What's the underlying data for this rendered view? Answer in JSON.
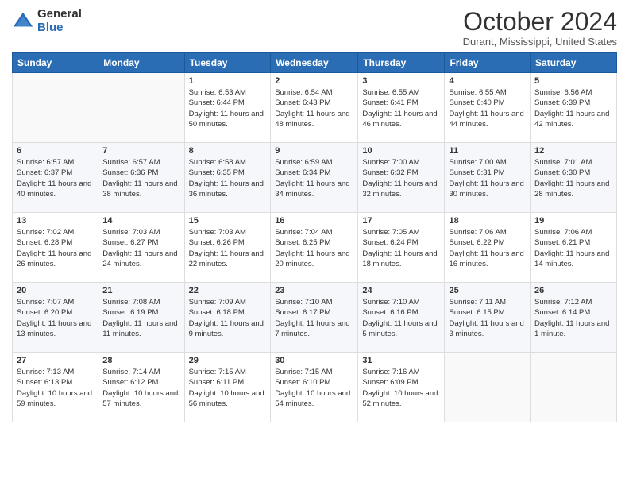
{
  "header": {
    "logo_general": "General",
    "logo_blue": "Blue",
    "month_title": "October 2024",
    "location": "Durant, Mississippi, United States"
  },
  "days_of_week": [
    "Sunday",
    "Monday",
    "Tuesday",
    "Wednesday",
    "Thursday",
    "Friday",
    "Saturday"
  ],
  "weeks": [
    [
      {
        "day": "",
        "info": ""
      },
      {
        "day": "",
        "info": ""
      },
      {
        "day": "1",
        "info": "Sunrise: 6:53 AM\nSunset: 6:44 PM\nDaylight: 11 hours and 50 minutes."
      },
      {
        "day": "2",
        "info": "Sunrise: 6:54 AM\nSunset: 6:43 PM\nDaylight: 11 hours and 48 minutes."
      },
      {
        "day": "3",
        "info": "Sunrise: 6:55 AM\nSunset: 6:41 PM\nDaylight: 11 hours and 46 minutes."
      },
      {
        "day": "4",
        "info": "Sunrise: 6:55 AM\nSunset: 6:40 PM\nDaylight: 11 hours and 44 minutes."
      },
      {
        "day": "5",
        "info": "Sunrise: 6:56 AM\nSunset: 6:39 PM\nDaylight: 11 hours and 42 minutes."
      }
    ],
    [
      {
        "day": "6",
        "info": "Sunrise: 6:57 AM\nSunset: 6:37 PM\nDaylight: 11 hours and 40 minutes."
      },
      {
        "day": "7",
        "info": "Sunrise: 6:57 AM\nSunset: 6:36 PM\nDaylight: 11 hours and 38 minutes."
      },
      {
        "day": "8",
        "info": "Sunrise: 6:58 AM\nSunset: 6:35 PM\nDaylight: 11 hours and 36 minutes."
      },
      {
        "day": "9",
        "info": "Sunrise: 6:59 AM\nSunset: 6:34 PM\nDaylight: 11 hours and 34 minutes."
      },
      {
        "day": "10",
        "info": "Sunrise: 7:00 AM\nSunset: 6:32 PM\nDaylight: 11 hours and 32 minutes."
      },
      {
        "day": "11",
        "info": "Sunrise: 7:00 AM\nSunset: 6:31 PM\nDaylight: 11 hours and 30 minutes."
      },
      {
        "day": "12",
        "info": "Sunrise: 7:01 AM\nSunset: 6:30 PM\nDaylight: 11 hours and 28 minutes."
      }
    ],
    [
      {
        "day": "13",
        "info": "Sunrise: 7:02 AM\nSunset: 6:28 PM\nDaylight: 11 hours and 26 minutes."
      },
      {
        "day": "14",
        "info": "Sunrise: 7:03 AM\nSunset: 6:27 PM\nDaylight: 11 hours and 24 minutes."
      },
      {
        "day": "15",
        "info": "Sunrise: 7:03 AM\nSunset: 6:26 PM\nDaylight: 11 hours and 22 minutes."
      },
      {
        "day": "16",
        "info": "Sunrise: 7:04 AM\nSunset: 6:25 PM\nDaylight: 11 hours and 20 minutes."
      },
      {
        "day": "17",
        "info": "Sunrise: 7:05 AM\nSunset: 6:24 PM\nDaylight: 11 hours and 18 minutes."
      },
      {
        "day": "18",
        "info": "Sunrise: 7:06 AM\nSunset: 6:22 PM\nDaylight: 11 hours and 16 minutes."
      },
      {
        "day": "19",
        "info": "Sunrise: 7:06 AM\nSunset: 6:21 PM\nDaylight: 11 hours and 14 minutes."
      }
    ],
    [
      {
        "day": "20",
        "info": "Sunrise: 7:07 AM\nSunset: 6:20 PM\nDaylight: 11 hours and 13 minutes."
      },
      {
        "day": "21",
        "info": "Sunrise: 7:08 AM\nSunset: 6:19 PM\nDaylight: 11 hours and 11 minutes."
      },
      {
        "day": "22",
        "info": "Sunrise: 7:09 AM\nSunset: 6:18 PM\nDaylight: 11 hours and 9 minutes."
      },
      {
        "day": "23",
        "info": "Sunrise: 7:10 AM\nSunset: 6:17 PM\nDaylight: 11 hours and 7 minutes."
      },
      {
        "day": "24",
        "info": "Sunrise: 7:10 AM\nSunset: 6:16 PM\nDaylight: 11 hours and 5 minutes."
      },
      {
        "day": "25",
        "info": "Sunrise: 7:11 AM\nSunset: 6:15 PM\nDaylight: 11 hours and 3 minutes."
      },
      {
        "day": "26",
        "info": "Sunrise: 7:12 AM\nSunset: 6:14 PM\nDaylight: 11 hours and 1 minute."
      }
    ],
    [
      {
        "day": "27",
        "info": "Sunrise: 7:13 AM\nSunset: 6:13 PM\nDaylight: 10 hours and 59 minutes."
      },
      {
        "day": "28",
        "info": "Sunrise: 7:14 AM\nSunset: 6:12 PM\nDaylight: 10 hours and 57 minutes."
      },
      {
        "day": "29",
        "info": "Sunrise: 7:15 AM\nSunset: 6:11 PM\nDaylight: 10 hours and 56 minutes."
      },
      {
        "day": "30",
        "info": "Sunrise: 7:15 AM\nSunset: 6:10 PM\nDaylight: 10 hours and 54 minutes."
      },
      {
        "day": "31",
        "info": "Sunrise: 7:16 AM\nSunset: 6:09 PM\nDaylight: 10 hours and 52 minutes."
      },
      {
        "day": "",
        "info": ""
      },
      {
        "day": "",
        "info": ""
      }
    ]
  ]
}
